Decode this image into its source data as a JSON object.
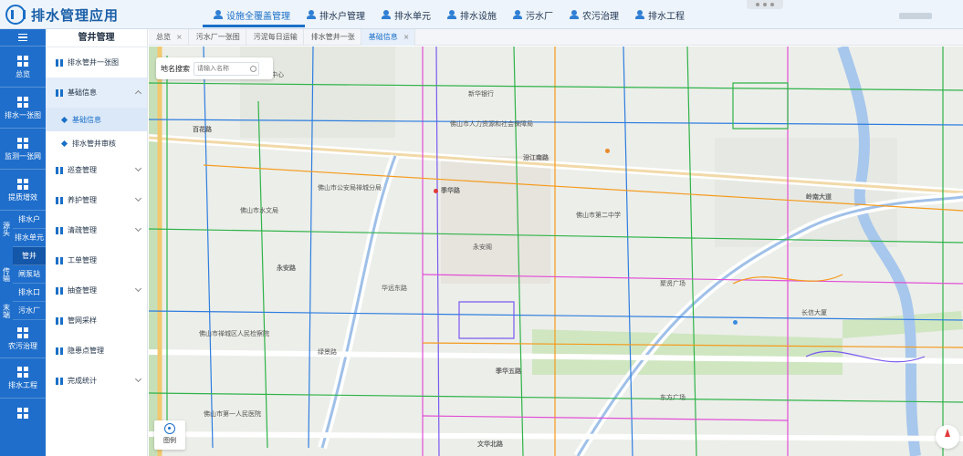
{
  "app": {
    "title": "排水管理应用"
  },
  "topnav": [
    {
      "label": "设施全覆盖管理",
      "active": true
    },
    {
      "label": "排水户管理"
    },
    {
      "label": "排水单元"
    },
    {
      "label": "排水设施"
    },
    {
      "label": "污水厂"
    },
    {
      "label": "农污治理"
    },
    {
      "label": "排水工程"
    }
  ],
  "rail": {
    "items": [
      {
        "label": "总览"
      },
      {
        "label": "排水一张图"
      },
      {
        "label": "监测一张网"
      },
      {
        "label": "提质增效"
      }
    ],
    "group1": {
      "label": "源头",
      "subs": [
        "排水户",
        "排水单元"
      ]
    },
    "group2": {
      "label": "传输",
      "subs": [
        "管井",
        "闸泵站",
        "排水口"
      ],
      "selected": "管井"
    },
    "group3": {
      "label": "末端",
      "subs": [
        "污水厂"
      ]
    },
    "bottom": [
      {
        "label": "农污治理"
      },
      {
        "label": "排水工程"
      }
    ]
  },
  "sidebar": {
    "title": "管井管理",
    "items": [
      {
        "label": "排水管井一张图"
      },
      {
        "label": "基础信息",
        "open": true,
        "subs": [
          {
            "label": "基础信息",
            "active": true
          },
          {
            "label": "排水管井审核"
          }
        ]
      },
      {
        "label": "巡查管理"
      },
      {
        "label": "养护管理"
      },
      {
        "label": "清疏管理"
      },
      {
        "label": "工单管理"
      },
      {
        "label": "抽查管理"
      },
      {
        "label": "管网采样"
      },
      {
        "label": "隐患点管理"
      },
      {
        "label": "完成统计"
      }
    ]
  },
  "tabs": [
    {
      "label": "总览"
    },
    {
      "label": "污水厂一张图"
    },
    {
      "label": "污泥每日运输"
    },
    {
      "label": "排水管井一张"
    },
    {
      "label": "基础信息",
      "active": true
    }
  ],
  "map": {
    "search_label": "地名搜索",
    "search_placeholder": "请输入名称",
    "legend_label": "图例",
    "roads": [
      "百花路",
      "汾江南路",
      "卫生中心",
      "佛山市人力资源和社会保障局",
      "季华路",
      "季华五路",
      "文华北路",
      "岭南大道",
      "永安路"
    ],
    "places": [
      "佛山市第二中学",
      "佛山市公安局禅城分局",
      "佛山市水文局",
      "永安阁",
      "华远东路",
      "绿景路",
      "长信大厦",
      "佛山市第一人民医院",
      "佛山市禅城区人民检察院",
      "新华银行",
      "聚贤广场",
      "东方广场"
    ]
  }
}
